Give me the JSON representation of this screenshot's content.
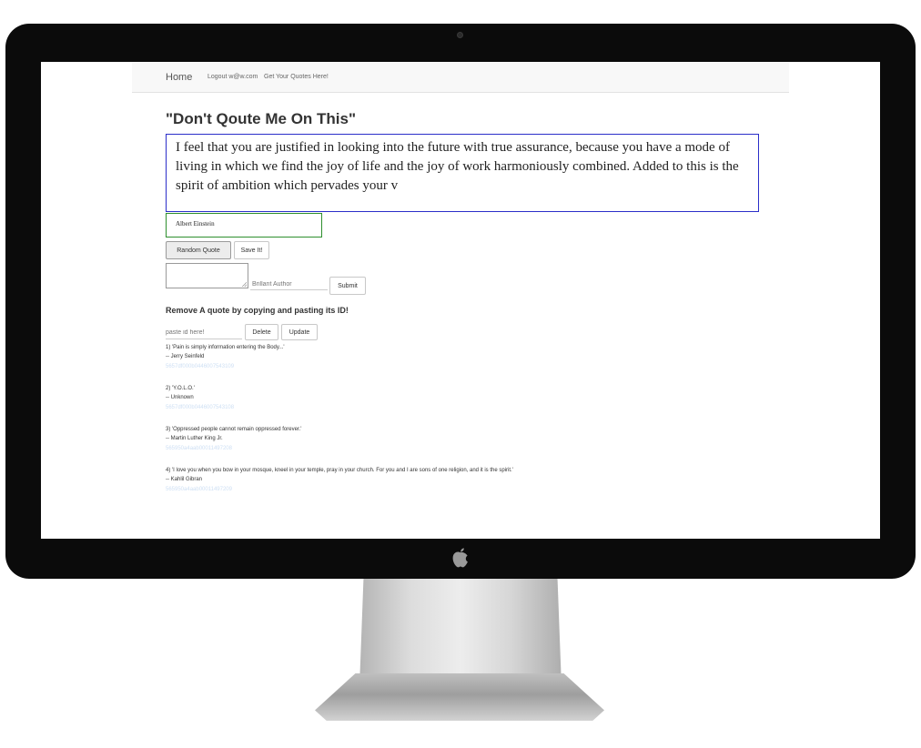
{
  "navbar": {
    "home": "Home",
    "logout": "Logout w@w.com",
    "get_quotes": "Get Your Quotes Here!"
  },
  "page": {
    "title": "\"Don't Qoute Me On This\"",
    "quote_text": "I feel that you are justified in looking into the future with true assurance, because you have a mode of living in which we find the joy of life and the joy of work harmoniously combined. Added to this is the spirit of ambition which pervades your v",
    "quote_author": "Albert Einstein"
  },
  "actions": {
    "random_quote": "Random Quote",
    "save_it": "Save It!"
  },
  "new_quote_form": {
    "author_placeholder": "Brillant Author",
    "submit": "Submit"
  },
  "remove": {
    "heading": "Remove A quote by copying and pasting its ID!",
    "id_placeholder": "paste id here!",
    "delete": "Delete",
    "update": "Update"
  },
  "quotes": [
    {
      "text": "1) 'Pain is simply information entering the Body...'",
      "author": "-- Jerry Seinfeld",
      "id": "5657df000b0446007543109"
    },
    {
      "text": "2) 'Y.O.L.O.'",
      "author": "-- Unknown",
      "id": "5657df000b0446007543108"
    },
    {
      "text": "3) 'Oppressed people cannot remain oppressed forever.'",
      "author": "-- Martin Luther King Jr.",
      "id": "565950a4aab00011497208"
    },
    {
      "text": "4) 'I love you when you bow in your mosque, kneel in your temple, pray in your church. For you and I are sons of one religion, and it is the spirit.'",
      "author": "-- Kahlil Gibran",
      "id": "565950a4aab00011497209"
    }
  ],
  "colors": {
    "quote_border": "#2b2ec9",
    "author_border": "#2e8f2e",
    "id_text": "#cfe0f4"
  },
  "icons": {
    "apple": "apple-logo-icon"
  }
}
